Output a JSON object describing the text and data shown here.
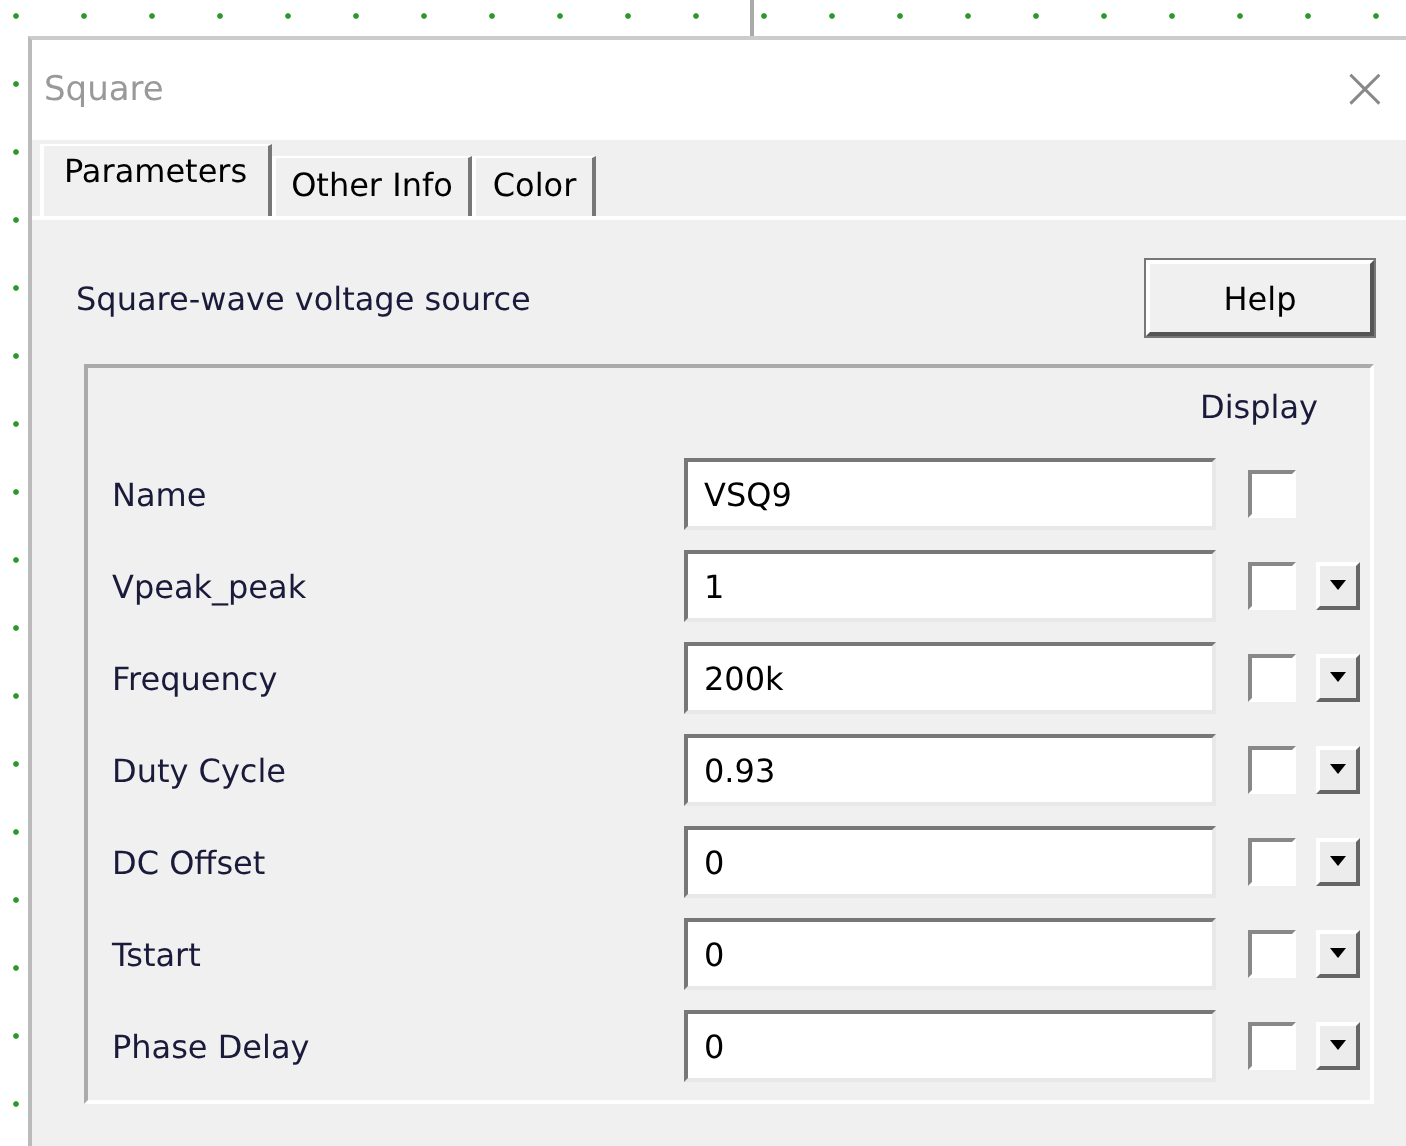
{
  "window": {
    "title": "Square",
    "close": "×"
  },
  "tabs": [
    {
      "label": "Parameters",
      "selected": true
    },
    {
      "label": "Other Info",
      "selected": false
    },
    {
      "label": "Color",
      "selected": false
    }
  ],
  "description": "Square-wave voltage source",
  "help_button": "Help",
  "display_header": "Display",
  "parameters": [
    {
      "kind": "plain",
      "label": "Name",
      "value": "VSQ9",
      "checked": false
    },
    {
      "kind": "dropdown",
      "label": "Vpeak_peak",
      "value": "1",
      "checked": false
    },
    {
      "kind": "dropdown",
      "label": "Frequency",
      "value": "200k",
      "checked": false
    },
    {
      "kind": "dropdown",
      "label": "Duty Cycle",
      "value": "0.93",
      "checked": false
    },
    {
      "kind": "dropdown",
      "label": "DC Offset",
      "value": "0",
      "checked": false
    },
    {
      "kind": "dropdown",
      "label": "Tstart",
      "value": "0",
      "checked": false
    },
    {
      "kind": "dropdown",
      "label": "Phase Delay",
      "value": "0",
      "checked": false
    }
  ]
}
